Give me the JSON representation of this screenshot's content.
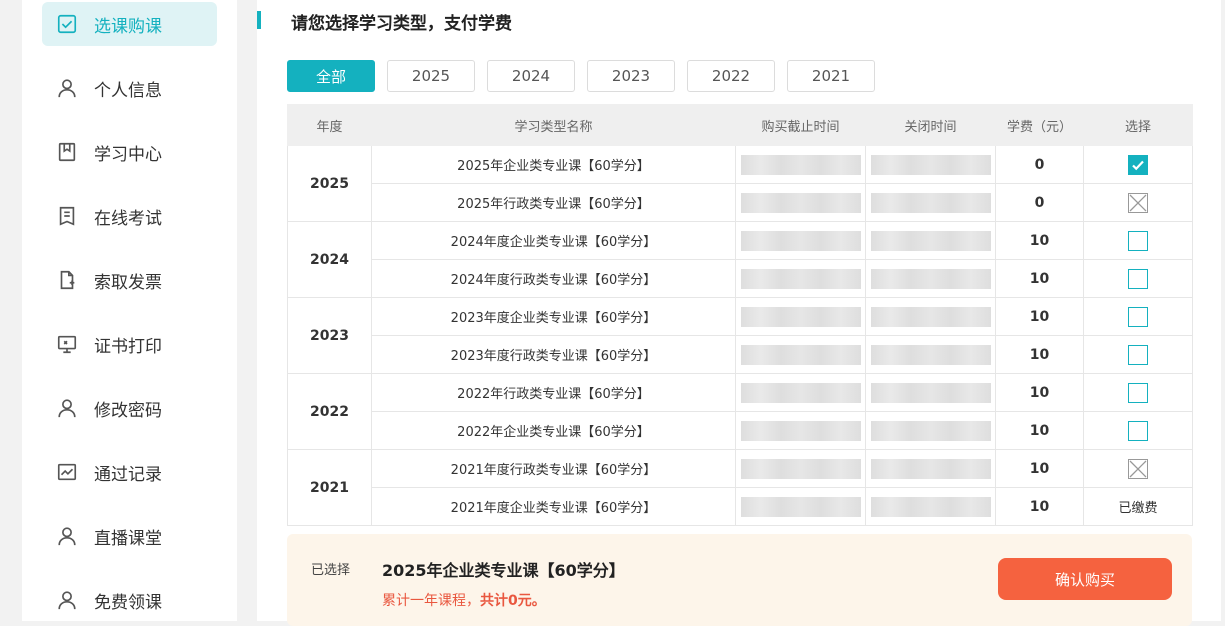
{
  "sidebar": {
    "items": [
      {
        "label": "选课购课",
        "icon": "checkbox-icon",
        "active": true
      },
      {
        "label": "个人信息",
        "icon": "user-icon"
      },
      {
        "label": "学习中心",
        "icon": "bookmark-icon"
      },
      {
        "label": "在线考试",
        "icon": "document-icon"
      },
      {
        "label": "索取发票",
        "icon": "file-add-icon"
      },
      {
        "label": "证书打印",
        "icon": "monitor-icon"
      },
      {
        "label": "修改密码",
        "icon": "user-icon"
      },
      {
        "label": "通过记录",
        "icon": "chart-icon"
      },
      {
        "label": "直播课堂",
        "icon": "user-icon"
      },
      {
        "label": "免费领课",
        "icon": "user-icon"
      }
    ]
  },
  "main": {
    "title": "请您选择学习类型，支付学费",
    "tabs": [
      "全部",
      "2025",
      "2024",
      "2023",
      "2022",
      "2021"
    ],
    "active_tab": "全部",
    "table": {
      "headers": [
        "年度",
        "学习类型名称",
        "购买截止时间",
        "关闭时间",
        "学费（元）",
        "选择"
      ],
      "groups": [
        {
          "year": "2025",
          "rows": [
            {
              "name": "2025年企业类专业课【60学分】",
              "fee": "0",
              "state": "checked"
            },
            {
              "name": "2025年行政类专业课【60学分】",
              "fee": "0",
              "state": "disabled"
            }
          ]
        },
        {
          "year": "2024",
          "rows": [
            {
              "name": "2024年度企业类专业课【60学分】",
              "fee": "10",
              "state": "unchecked"
            },
            {
              "name": "2024年度行政类专业课【60学分】",
              "fee": "10",
              "state": "unchecked"
            }
          ]
        },
        {
          "year": "2023",
          "rows": [
            {
              "name": "2023年度企业类专业课【60学分】",
              "fee": "10",
              "state": "unchecked"
            },
            {
              "name": "2023年度行政类专业课【60学分】",
              "fee": "10",
              "state": "unchecked"
            }
          ]
        },
        {
          "year": "2022",
          "rows": [
            {
              "name": "2022年行政类专业课【60学分】",
              "fee": "10",
              "state": "unchecked"
            },
            {
              "name": "2022年企业类专业课【60学分】",
              "fee": "10",
              "state": "unchecked"
            }
          ]
        },
        {
          "year": "2021",
          "rows": [
            {
              "name": "2021年度行政类专业课【60学分】",
              "fee": "10",
              "state": "disabled"
            },
            {
              "name": "2021年度企业类专业课【60学分】",
              "fee": "10",
              "state": "paid",
              "state_label": "已缴费"
            }
          ]
        }
      ]
    }
  },
  "summary": {
    "label": "已选择",
    "selected": "2025年企业类专业课【60学分】",
    "note_prefix": "累计一年课程，",
    "note_total": "共计0元。",
    "confirm_label": "确认购买"
  },
  "colors": {
    "accent": "#14b1bf",
    "fee": "#e9573f",
    "confirm": "#f5623f",
    "summary_bg": "#fdf5ea"
  }
}
